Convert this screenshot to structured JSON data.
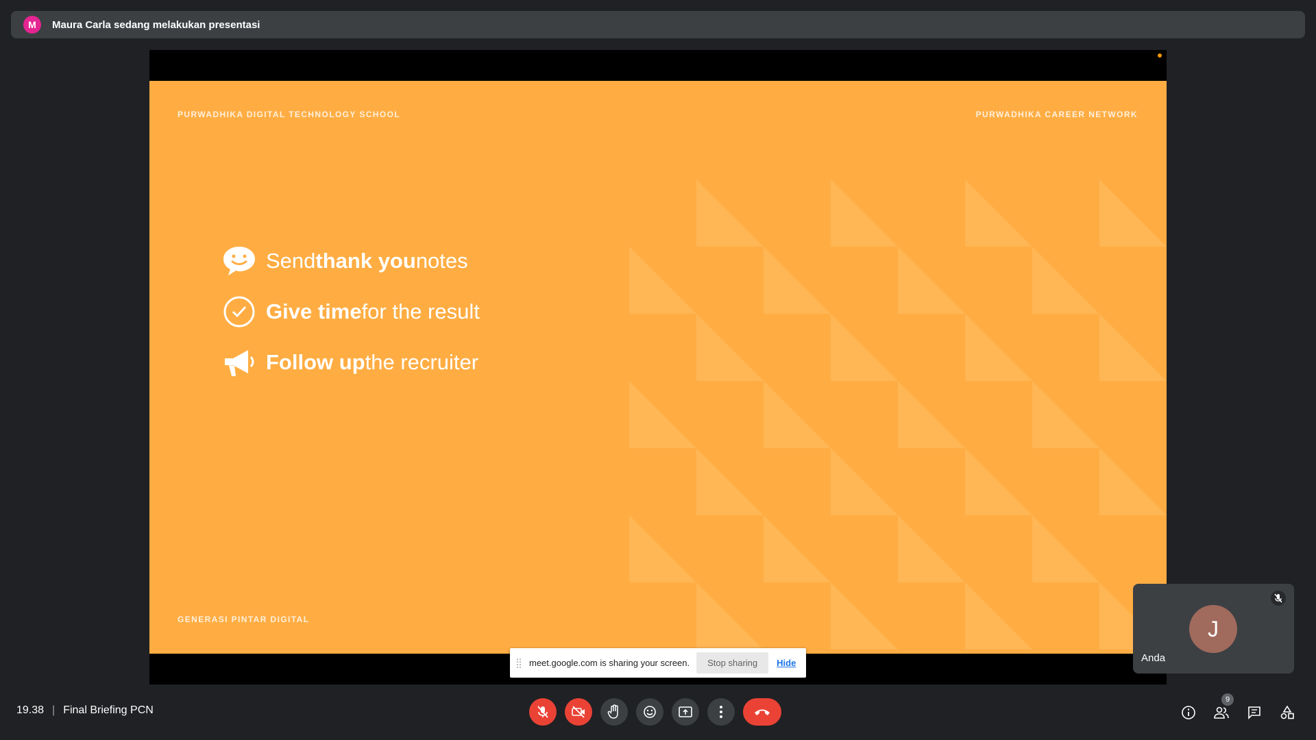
{
  "banner": {
    "avatar_letter": "M",
    "text": "Maura Carla sedang melakukan presentasi"
  },
  "slide": {
    "top_left": "PURWADHIKA DIGITAL TECHNOLOGY SCHOOL",
    "top_right": "PURWADHIKA CAREER NETWORK",
    "bottom_left": "GENERASI PINTAR DIGITAL",
    "bullets": [
      {
        "icon": "speech-bubble-icon",
        "pre": "Send ",
        "bold": "thank you",
        "post": " notes"
      },
      {
        "icon": "clock-check-icon",
        "pre": "",
        "bold": "Give time",
        "post": " for the result"
      },
      {
        "icon": "megaphone-icon",
        "pre": "",
        "bold": "Follow up",
        "post": " the recruiter"
      }
    ]
  },
  "share_bar": {
    "text": "meet.google.com is sharing your screen.",
    "stop_label": "Stop sharing",
    "hide_label": "Hide"
  },
  "self_tile": {
    "avatar_letter": "J",
    "name": "Anda"
  },
  "meeting": {
    "time": "19.38",
    "separator": "|",
    "title": "Final Briefing PCN"
  },
  "participants_count": "9",
  "colors": {
    "background": "#202124",
    "slide": "#ffad43",
    "danger": "#ea4335",
    "banner_avatar": "#e52592",
    "self_avatar": "#a06a5d"
  }
}
